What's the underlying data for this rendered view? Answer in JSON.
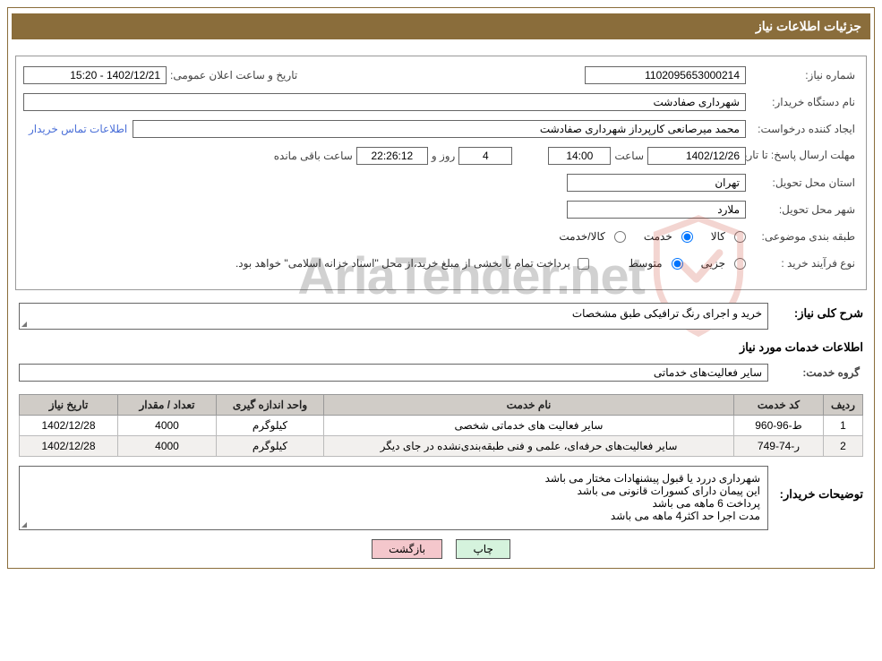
{
  "title": "جزئیات اطلاعات نیاز",
  "fields": {
    "need_no_label": "شماره نیاز:",
    "need_no": "1102095653000214",
    "announce_label": "تاریخ و ساعت اعلان عمومی:",
    "announce": "1402/12/21 - 15:20",
    "buyer_org_label": "نام دستگاه خریدار:",
    "buyer_org": "شهرداری صفادشت",
    "requester_label": "ایجاد کننده درخواست:",
    "requester": "محمد میرصانعی کارپرداز شهرداری صفادشت",
    "contact_link": "اطلاعات تماس خریدار",
    "deadline_label": "مهلت ارسال پاسخ: تا تاریخ:",
    "deadline_date": "1402/12/26",
    "time_label": "ساعت",
    "deadline_time": "14:00",
    "days": "4",
    "days_label": "روز و",
    "countdown": "22:26:12",
    "remaining_label": "ساعت باقی مانده",
    "province_label": "استان محل تحویل:",
    "province": "تهران",
    "city_label": "شهر محل تحویل:",
    "city": "ملارد",
    "category_label": "طبقه بندی موضوعی:",
    "opt_goods": "کالا",
    "opt_service": "خدمت",
    "opt_both": "کالا/خدمت",
    "purchase_type_label": "نوع فرآیند خرید :",
    "opt_minor": "جزیی",
    "opt_medium": "متوسط",
    "payment_note": "پرداخت تمام یا بخشی از مبلغ خرید،از محل \"اسناد خزانه اسلامی\" خواهد بود."
  },
  "desc": {
    "label": "شرح کلی نیاز:",
    "text": "خرید و اجرای رنگ ترافیکی طبق مشخصات"
  },
  "services_header": "اطلاعات خدمات مورد نیاز",
  "service_group_label": "گروه خدمت:",
  "service_group": "سایر فعالیت‌های خدماتی",
  "table": {
    "headers": {
      "row": "ردیف",
      "code": "کد خدمت",
      "name": "نام خدمت",
      "unit": "واحد اندازه گیری",
      "qty": "تعداد / مقدار",
      "date": "تاریخ نیاز"
    },
    "rows": [
      {
        "n": "1",
        "code": "ط-96-960",
        "name": "سایر فعالیت های خدماتی شخصی",
        "unit": "کیلوگرم",
        "qty": "4000",
        "date": "1402/12/28"
      },
      {
        "n": "2",
        "code": "ر-74-749",
        "name": "سایر فعالیت‌های حرفه‌ای، علمی و فنی طبقه‌بندی‌نشده در جای دیگر",
        "unit": "کیلوگرم",
        "qty": "4000",
        "date": "1402/12/28"
      }
    ]
  },
  "buyer_notes_label": "توضیحات خریدار:",
  "buyer_notes": "شهرداری دررد یا قبول پیشنهادات مختار می باشد\nاین پیمان دارای کسورات قانونی می باشد\nپرداخت 6 ماهه می باشد\nمدت اجرا حد اکثر4 ماهه می باشد",
  "buttons": {
    "print": "چاپ",
    "back": "بازگشت"
  },
  "watermark": "AriaTender.net"
}
